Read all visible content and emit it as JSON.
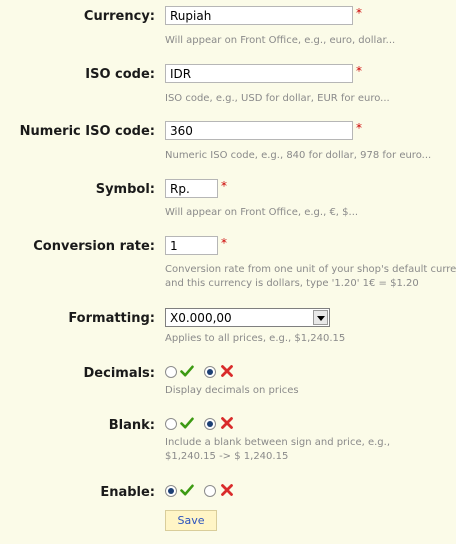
{
  "fields": {
    "currency": {
      "label": "Currency:",
      "value": "Rupiah",
      "hint": "Will appear on Front Office, e.g., euro, dollar..."
    },
    "iso_code": {
      "label": "ISO code:",
      "value": "IDR",
      "hint": "ISO code, e.g., USD for dollar, EUR for euro..."
    },
    "numeric_iso": {
      "label": "Numeric ISO code:",
      "value": "360",
      "hint": "Numeric ISO code, e.g., 840 for dollar, 978 for euro..."
    },
    "symbol": {
      "label": "Symbol:",
      "value": "Rp.",
      "hint": "Will appear on Front Office, e.g., €, $..."
    },
    "conversion": {
      "label": "Conversion rate:",
      "value": "1",
      "hint_line1": "Conversion rate from one unit of your shop's default currency",
      "hint_line2": "and this currency is dollars, type '1.20' 1€ = $1.20"
    },
    "formatting": {
      "label": "Formatting:",
      "value": "X0.000,00",
      "hint": "Applies to all prices, e.g., $1,240.15"
    },
    "decimals": {
      "label": "Decimals:",
      "selected": "no",
      "hint": "Display decimals on prices"
    },
    "blank": {
      "label": "Blank:",
      "selected": "no",
      "hint_line1": "Include a blank between sign and price, e.g.,",
      "hint_line2": "$1,240.15 -> $ 1,240.15"
    },
    "enable": {
      "label": "Enable:",
      "selected": "yes"
    }
  },
  "required_marker": "*",
  "save_label": "Save",
  "colors": {
    "background": "#fbfbe8",
    "yes_icon": "#3c9a12",
    "no_icon": "#d92b2b",
    "required": "#cc0000",
    "hint": "#8a8a8a"
  }
}
